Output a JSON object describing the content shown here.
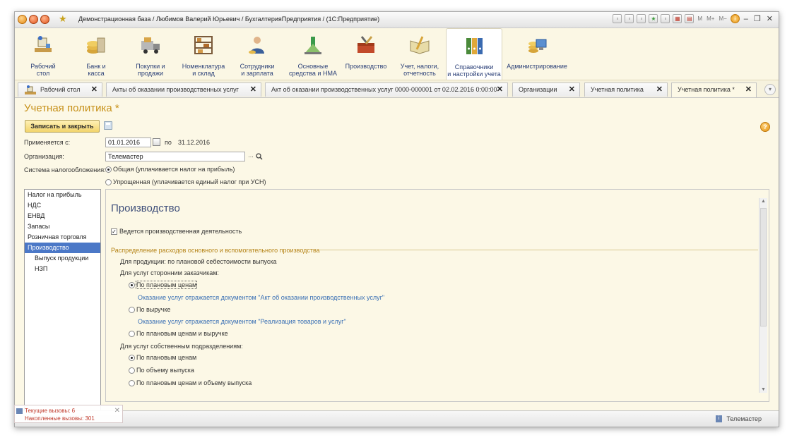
{
  "window": {
    "title": "Демонстрационная база / Любимов Валерий Юрьевич / БухгалтерияПредприятия /  (1С:Предприятие)"
  },
  "toolbar_right": {
    "m": "M",
    "mplus": "M+",
    "mminus": "M−"
  },
  "sections": [
    {
      "label": "Рабочий\nстол"
    },
    {
      "label": "Банк и\nкасса"
    },
    {
      "label": "Покупки и\nпродажи"
    },
    {
      "label": "Номенклатура\nи склад"
    },
    {
      "label": "Сотрудники\nи зарплата"
    },
    {
      "label": "Основные\nсредства и НМА"
    },
    {
      "label": "Производство"
    },
    {
      "label": "Учет, налоги,\nотчетность"
    },
    {
      "label": "Справочники\nи настройки учета"
    },
    {
      "label": "Администрирование"
    }
  ],
  "tabs": [
    {
      "label": "Рабочий стол"
    },
    {
      "label": "Акты об оказании производственных услуг"
    },
    {
      "label": "Акт об оказании производственных услуг 0000-000001 от 02.02.2016 0:00:00 *"
    },
    {
      "label": "Организации"
    },
    {
      "label": "Учетная политика"
    },
    {
      "label": "Учетная политика *"
    }
  ],
  "form": {
    "title": "Учетная политика *",
    "save_close": "Записать и закрыть",
    "help": "?",
    "applies_label": "Применяется с:",
    "date_from": "01.01.2016",
    "po_label": "по",
    "date_to": "31.12.2016",
    "org_label": "Организация:",
    "org_value": "Телемастер",
    "dots": "...",
    "tax_label": "Система налогообложения:",
    "tax_general": "Общая (уплачивается налог на прибыль)",
    "tax_simple": "Упрощенная (уплачивается единый налог при УСН)"
  },
  "sidebar": [
    {
      "label": "Налог на прибыль"
    },
    {
      "label": "НДС"
    },
    {
      "label": "ЕНВД"
    },
    {
      "label": "Запасы"
    },
    {
      "label": "Розничная торговля"
    },
    {
      "label": "Производство"
    },
    {
      "label": "Выпуск продукции"
    },
    {
      "label": "НЗП"
    }
  ],
  "panel": {
    "heading": "Производство",
    "production_flag": "Ведется производственная деятельность",
    "group_title": "Распределение расходов основного и вспомогательного производства",
    "products_line": "Для продукции: по плановой себестоимости выпуска",
    "third_party_label": "Для услуг сторонним заказчикам:",
    "opt_planned": "По плановым ценам",
    "hint_act": "Оказание услуг отражается документом \"Акт об оказании производственных услуг\"",
    "opt_revenue": "По выручке",
    "hint_sale": "Оказание услуг отражается документом \"Реализация товаров и услуг\"",
    "opt_planned_revenue": "По плановым ценам и выручке",
    "own_units_label": "Для услуг собственным подразделениям:",
    "opt_own_planned": "По плановым ценам",
    "opt_own_volume": "По объему выпуска",
    "opt_own_planned_volume": "По плановым ценам и объему выпуска"
  },
  "status": {
    "user": "Телемастер"
  },
  "popup": {
    "current_calls": "Текущие вызовы: 6",
    "accumulated_calls": "Накопленные вызовы: 301"
  }
}
